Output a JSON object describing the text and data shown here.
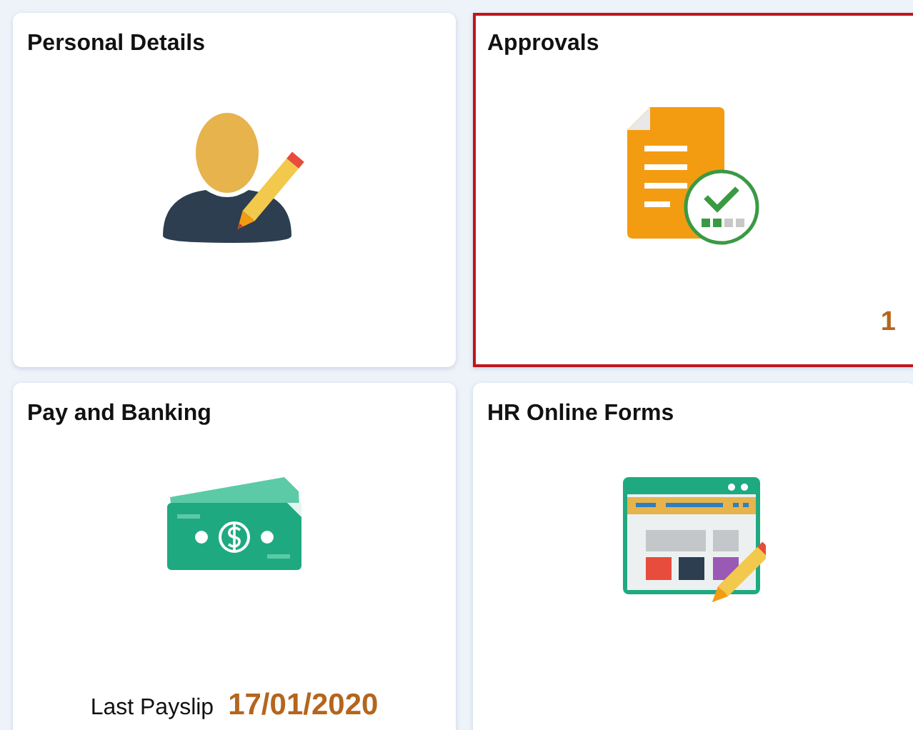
{
  "tiles": [
    {
      "title": "Personal Details",
      "selected": false
    },
    {
      "title": "Approvals",
      "selected": true,
      "count": "1"
    },
    {
      "title": "Pay and Banking",
      "selected": false,
      "footer": {
        "label": "Last Payslip",
        "value": "17/01/2020"
      }
    },
    {
      "title": "HR Online Forms",
      "selected": false
    }
  ]
}
